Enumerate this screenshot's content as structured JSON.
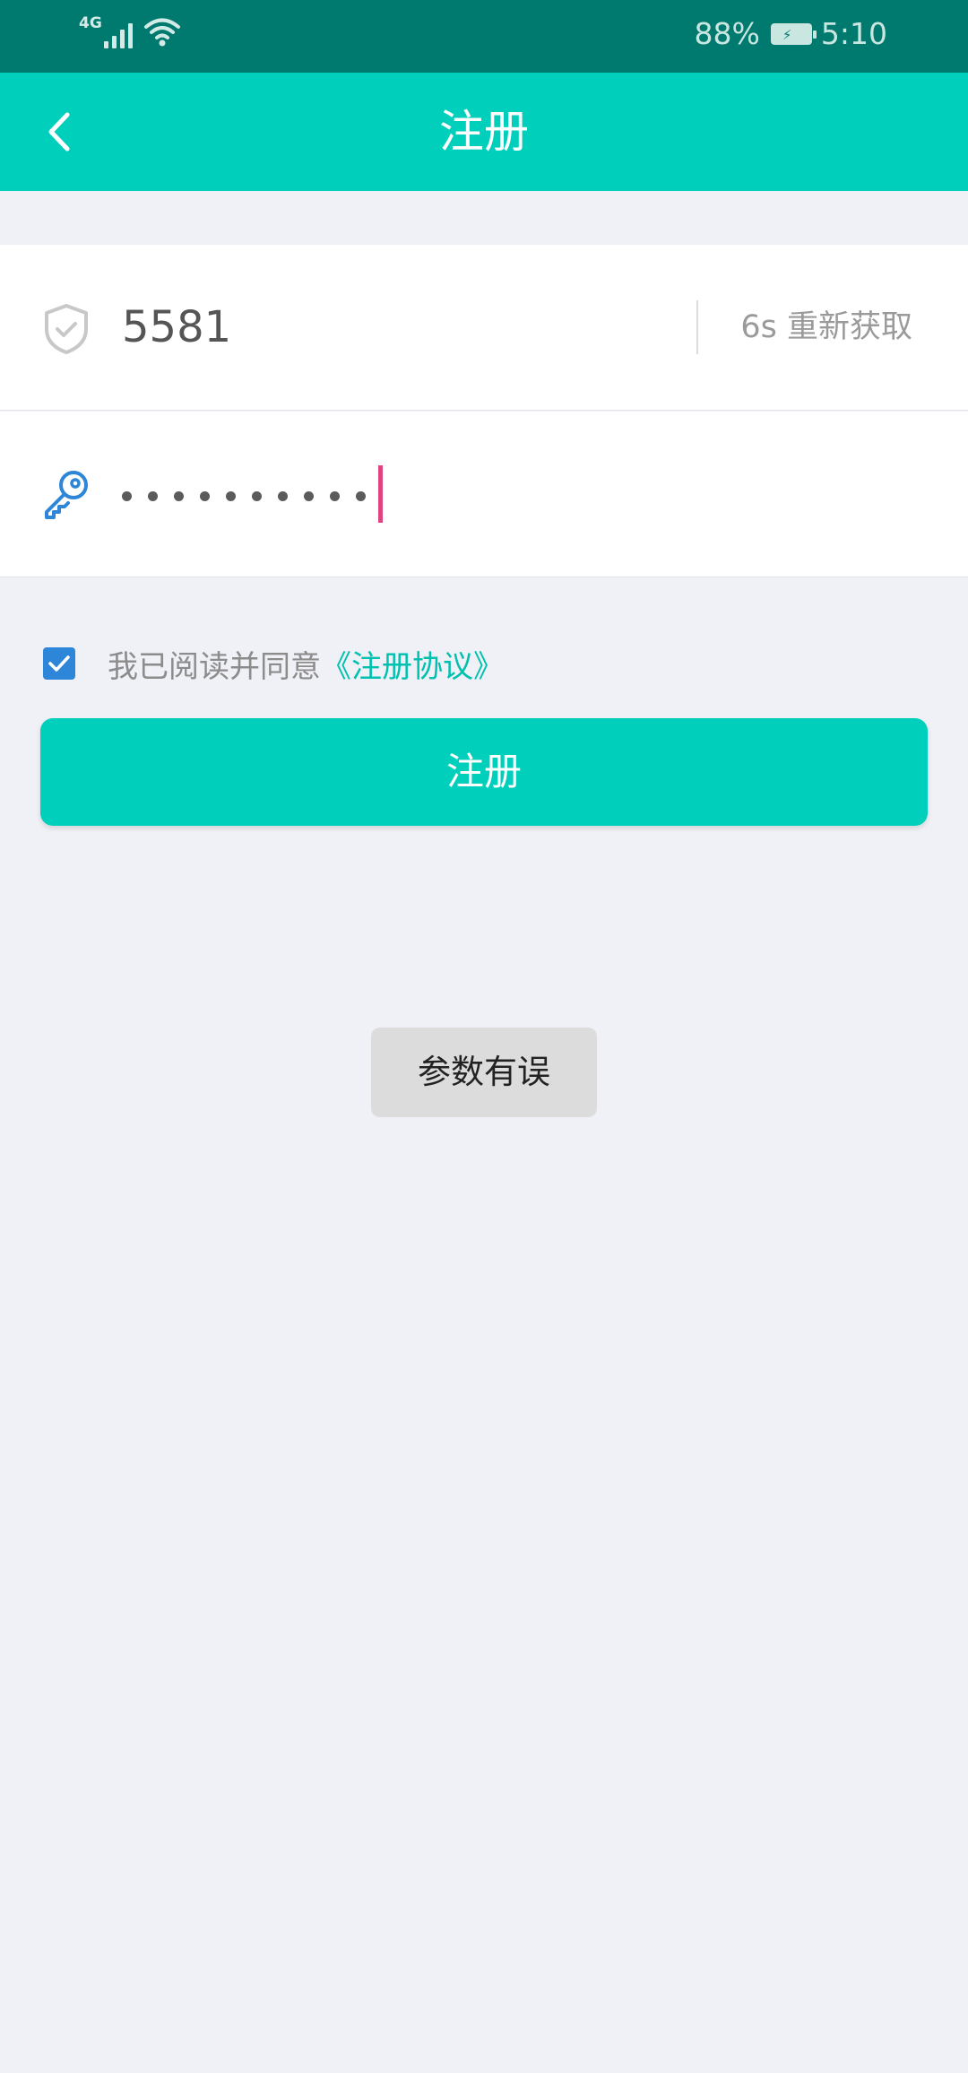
{
  "status_bar": {
    "network": "4G",
    "battery": "88%",
    "time": "5:10"
  },
  "header": {
    "title": "注册"
  },
  "verify_code": {
    "value": "5581",
    "resend_label": "6s 重新获取"
  },
  "password": {
    "masked_length": 10
  },
  "agreement": {
    "checked": true,
    "prefix": "我已阅读并同意",
    "link": "《注册协议》"
  },
  "register_button": {
    "label": "注册"
  },
  "toast": {
    "message": "参数有误"
  },
  "colors": {
    "status_bar": "#007a6e",
    "primary": "#00cfbc",
    "link": "#00c1af",
    "checkbox": "#2e86d8",
    "caret": "#e0447f",
    "background": "#f0f1f6"
  },
  "icons": {
    "back": "chevron-left-icon",
    "code_field": "shield-check-icon",
    "password_field": "key-icon",
    "checkbox": "check-icon"
  }
}
